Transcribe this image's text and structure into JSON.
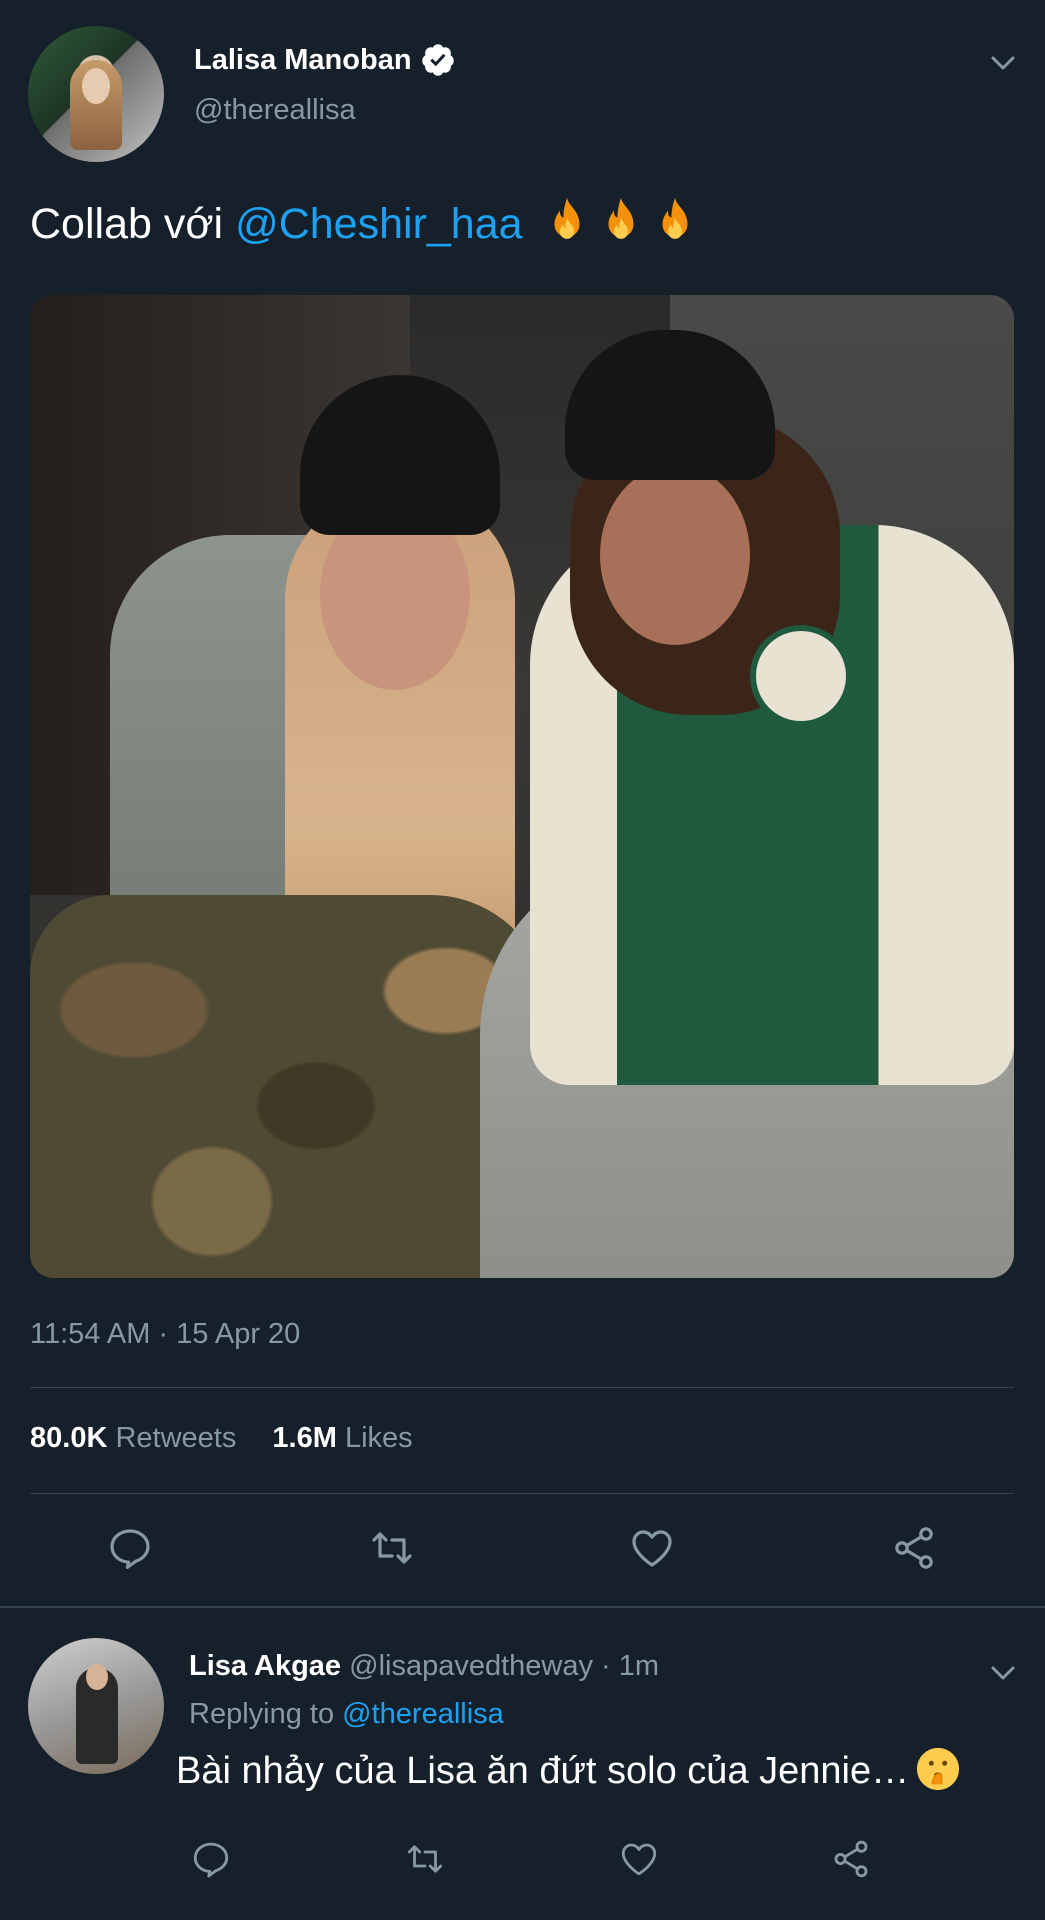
{
  "tweet": {
    "display_name": "Lalisa Manoban",
    "handle": "@thereallisa",
    "text_prefix": "Collab  với",
    "mention": "@Cheshir_haa",
    "emojis": [
      "🔥",
      "🔥",
      "🔥"
    ],
    "timestamp": "11:54 AM · 15 Apr 20",
    "retweets_count": "80.0K",
    "retweets_label": "Retweets",
    "likes_count": "1.6M",
    "likes_label": "Likes",
    "icons": [
      "verified-badge-icon",
      "chevron-down-icon",
      "reply-icon",
      "retweet-icon",
      "like-icon",
      "share-icon"
    ]
  },
  "reply": {
    "display_name": "Lisa Akgae",
    "handle": "@lisapavedtheway",
    "separator": "·",
    "time": "1m",
    "replying_label": "Replying to",
    "replying_to": "@thereallisa",
    "text": "Bài nhảy của Lisa ăn đứt solo của Jennie…",
    "emoji": "🤫",
    "icons": [
      "chevron-down-icon",
      "reply-icon",
      "retweet-icon",
      "like-icon",
      "share-icon"
    ]
  },
  "colors": {
    "background": "#15202b",
    "text": "#ffffff",
    "secondary_text": "#8899a6",
    "link": "#1da1f2",
    "divider": "#38444d"
  }
}
